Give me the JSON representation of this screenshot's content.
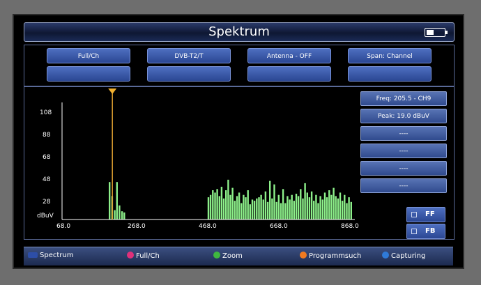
{
  "title": "Spektrum",
  "colors": {
    "accent_blue": "#3a5aa8",
    "trace_green": "#8df08a",
    "marker_orange": "#e0a030"
  },
  "top_buttons": [
    {
      "label": "Full/Ch"
    },
    {
      "label": "DVB-T2/T"
    },
    {
      "label": "Antenna - OFF"
    },
    {
      "label": "Span: Channel"
    }
  ],
  "info": {
    "freq": "Freq: 205.5 - CH9",
    "peak": "Peak: 19.0 dBuV",
    "blank1": "----",
    "blank2": "----",
    "blank3": "----",
    "blank4": "----"
  },
  "side_buttons": {
    "ff": "FF",
    "fb": "FB"
  },
  "bottom": {
    "spectrum": "Spectrum",
    "fullch": "Full/Ch",
    "zoom": "Zoom",
    "program": "Programmsuch",
    "capturing": "Capturing"
  },
  "chart_data": {
    "type": "bar",
    "xlabel": "",
    "ylabel": "dBuV",
    "x_ticks": [
      "68.0",
      "268.0",
      "468.0",
      "668.0",
      "868.0"
    ],
    "y_ticks": [
      "108",
      "88",
      "68",
      "48",
      "28"
    ],
    "xlim": [
      68,
      868
    ],
    "ylim": [
      10,
      110
    ],
    "marker_x": 205.5,
    "x": [
      198,
      205,
      212,
      218,
      225,
      232,
      238,
      468,
      474,
      480,
      486,
      492,
      498,
      504,
      510,
      516,
      522,
      528,
      534,
      540,
      546,
      552,
      558,
      564,
      570,
      576,
      582,
      588,
      594,
      600,
      606,
      612,
      618,
      624,
      630,
      636,
      642,
      648,
      654,
      660,
      666,
      672,
      678,
      684,
      690,
      696,
      702,
      708,
      714,
      720,
      726,
      732,
      738,
      744,
      750,
      756,
      762,
      768,
      774,
      780,
      786,
      792,
      798,
      804,
      810,
      816,
      822,
      828,
      834,
      840,
      846,
      852,
      858
    ],
    "values": [
      42,
      30,
      18,
      42,
      22,
      17,
      16,
      29,
      31,
      35,
      33,
      36,
      30,
      38,
      28,
      35,
      44,
      31,
      37,
      26,
      30,
      33,
      24,
      31,
      29,
      35,
      23,
      27,
      26,
      28,
      29,
      31,
      27,
      34,
      25,
      43,
      28,
      40,
      25,
      31,
      24,
      36,
      24,
      30,
      27,
      31,
      26,
      32,
      30,
      36,
      28,
      41,
      33,
      29,
      34,
      26,
      31,
      24,
      30,
      27,
      33,
      29,
      35,
      31,
      37,
      30,
      28,
      33,
      26,
      31,
      24,
      29,
      25
    ]
  }
}
